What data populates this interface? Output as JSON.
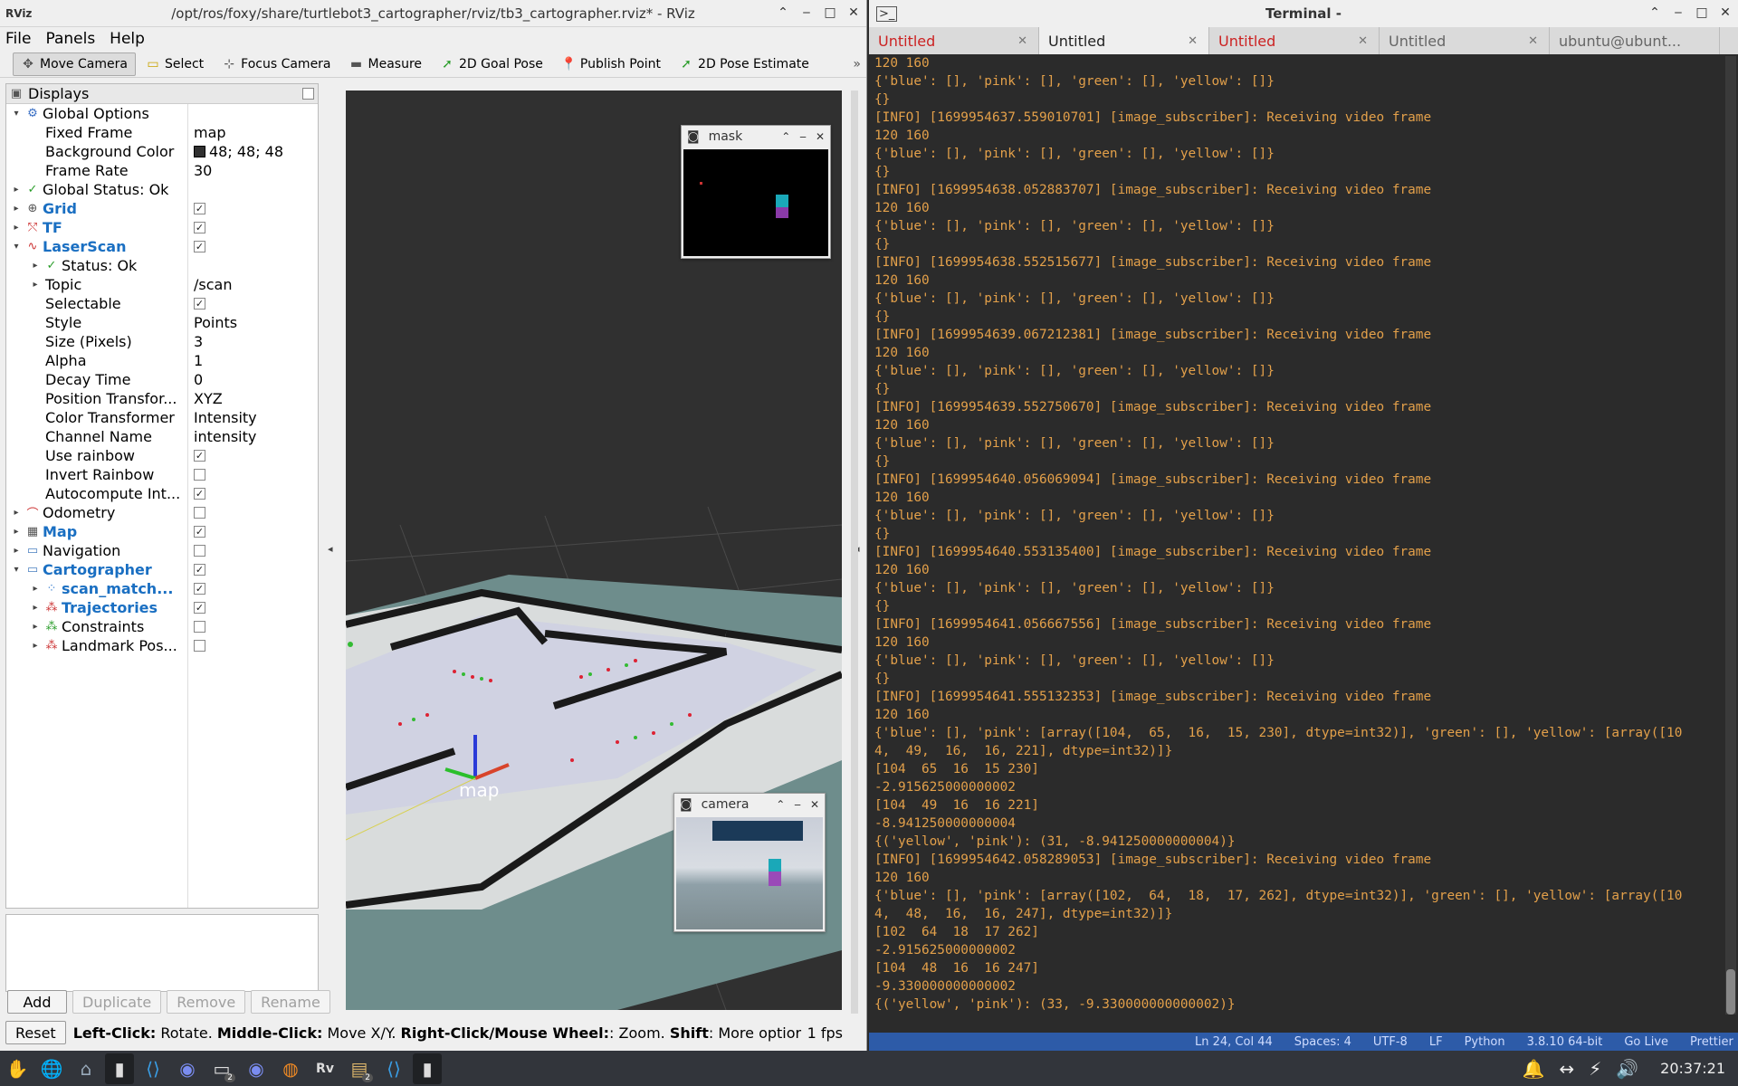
{
  "rviz": {
    "app_icon": "RViz",
    "title": "/opt/ros/foxy/share/turtlebot3_cartographer/rviz/tb3_cartographer.rviz* - RViz",
    "menu": [
      "File",
      "Panels",
      "Help"
    ],
    "tools": [
      {
        "label": "Move Camera",
        "icon": "move-camera-icon"
      },
      {
        "label": "Select",
        "icon": "select-icon"
      },
      {
        "label": "Focus Camera",
        "icon": "focus-camera-icon"
      },
      {
        "label": "Measure",
        "icon": "measure-icon"
      },
      {
        "label": "2D Goal Pose",
        "icon": "goal-pose-icon"
      },
      {
        "label": "Publish Point",
        "icon": "publish-point-icon"
      },
      {
        "label": "2D Pose Estimate",
        "icon": "pose-estimate-icon"
      }
    ],
    "displays_title": "Displays",
    "tree": [
      {
        "indent": 0,
        "arrow": "▾",
        "icon": "⚙",
        "icolor": "#3a6fc4",
        "name": "Global Options",
        "bold": false,
        "value": ""
      },
      {
        "indent": 1,
        "arrow": "",
        "name": "Fixed Frame",
        "value": "map"
      },
      {
        "indent": 1,
        "arrow": "",
        "name": "Background Color",
        "value": "48; 48; 48",
        "swatch": "#303030"
      },
      {
        "indent": 1,
        "arrow": "",
        "name": "Frame Rate",
        "value": "30"
      },
      {
        "indent": 0,
        "arrow": "▸",
        "icon": "✓",
        "icolor": "#2a9d2a",
        "name": "Global Status: Ok",
        "value": ""
      },
      {
        "indent": 0,
        "arrow": "▸",
        "icon": "⊕",
        "icolor": "#555",
        "name": "Grid",
        "bold": true,
        "check": true
      },
      {
        "indent": 0,
        "arrow": "▸",
        "icon": "⤲",
        "icolor": "#c33",
        "name": "TF",
        "bold": true,
        "check": true
      },
      {
        "indent": 0,
        "arrow": "▾",
        "icon": "∿",
        "icolor": "#c33",
        "name": "LaserScan",
        "bold": true,
        "check": true
      },
      {
        "indent": 1,
        "arrow": "▸",
        "icon": "✓",
        "icolor": "#2a9d2a",
        "name": "Status: Ok",
        "value": ""
      },
      {
        "indent": 1,
        "arrow": "▸",
        "name": "Topic",
        "value": "/scan"
      },
      {
        "indent": 1,
        "arrow": "",
        "name": "Selectable",
        "check": true
      },
      {
        "indent": 1,
        "arrow": "",
        "name": "Style",
        "value": "Points"
      },
      {
        "indent": 1,
        "arrow": "",
        "name": "Size (Pixels)",
        "value": "3"
      },
      {
        "indent": 1,
        "arrow": "",
        "name": "Alpha",
        "value": "1"
      },
      {
        "indent": 1,
        "arrow": "",
        "name": "Decay Time",
        "value": "0"
      },
      {
        "indent": 1,
        "arrow": "",
        "name": "Position Transfor...",
        "value": "XYZ"
      },
      {
        "indent": 1,
        "arrow": "",
        "name": "Color Transformer",
        "value": "Intensity"
      },
      {
        "indent": 1,
        "arrow": "",
        "name": "Channel Name",
        "value": "intensity"
      },
      {
        "indent": 1,
        "arrow": "",
        "name": "Use rainbow",
        "check": true
      },
      {
        "indent": 1,
        "arrow": "",
        "name": "Invert Rainbow",
        "check": false
      },
      {
        "indent": 1,
        "arrow": "",
        "name": "Autocompute Int...",
        "check": true
      },
      {
        "indent": 0,
        "arrow": "▸",
        "icon": "⌒",
        "icolor": "#c33",
        "name": "Odometry",
        "check": false
      },
      {
        "indent": 0,
        "arrow": "▸",
        "icon": "▦",
        "icolor": "#555",
        "name": "Map",
        "bold": true,
        "check": true
      },
      {
        "indent": 0,
        "arrow": "▸",
        "icon": "▭",
        "icolor": "#4a7fc0",
        "name": "Navigation",
        "check": false
      },
      {
        "indent": 0,
        "arrow": "▾",
        "icon": "▭",
        "icolor": "#4a7fc0",
        "name": "Cartographer",
        "bold": true,
        "check": true
      },
      {
        "indent": 1,
        "arrow": "▸",
        "icon": "⁘",
        "icolor": "#3a7fd0",
        "name": "scan_match...",
        "bold": true,
        "check": true
      },
      {
        "indent": 1,
        "arrow": "▸",
        "icon": "⁂",
        "icolor": "#c33",
        "name": "Trajectories",
        "bold": true,
        "check": true
      },
      {
        "indent": 1,
        "arrow": "▸",
        "icon": "⁂",
        "icolor": "#2a9d2a",
        "name": "Constraints",
        "check": false
      },
      {
        "indent": 1,
        "arrow": "▸",
        "icon": "⁂",
        "icolor": "#c33",
        "name": "Landmark Pos...",
        "check": false
      }
    ],
    "buttons": [
      {
        "label": "Add",
        "enabled": true
      },
      {
        "label": "Duplicate",
        "enabled": false
      },
      {
        "label": "Remove",
        "enabled": false
      },
      {
        "label": "Rename",
        "enabled": false
      }
    ],
    "reset_label": "Reset",
    "status_parts": [
      {
        "t": "Left-Click:",
        "b": true
      },
      {
        "t": " Rotate. ",
        "b": false
      },
      {
        "t": "Middle-Click:",
        "b": true
      },
      {
        "t": " Move X/Y. ",
        "b": false
      },
      {
        "t": "Right-Click/Mouse Wheel:",
        "b": true
      },
      {
        "t": ": Zoom. ",
        "b": false
      },
      {
        "t": "Shift",
        "b": true
      },
      {
        "t": ": More optior",
        "b": false
      }
    ],
    "fps": "1 fps",
    "map_label": "map",
    "mask_title": "mask",
    "camera_title": "camera"
  },
  "terminal": {
    "title": "Terminal -",
    "tabs": [
      {
        "label": "Untitled",
        "red": true,
        "active": false
      },
      {
        "label": "Untitled",
        "red": false,
        "active": true
      },
      {
        "label": "Untitled",
        "red": true,
        "active": false
      },
      {
        "label": "Untitled",
        "red": false,
        "active": false
      },
      {
        "label": "ubuntu@ubunt...",
        "red": false,
        "active": false
      }
    ],
    "lines": [
      "120 160",
      "{'blue': [], 'pink': [], 'green': [], 'yellow': []}",
      "{}",
      "[INFO] [1699954637.559010701] [image_subscriber]: Receiving video frame",
      "120 160",
      "{'blue': [], 'pink': [], 'green': [], 'yellow': []}",
      "{}",
      "[INFO] [1699954638.052883707] [image_subscriber]: Receiving video frame",
      "120 160",
      "{'blue': [], 'pink': [], 'green': [], 'yellow': []}",
      "{}",
      "[INFO] [1699954638.552515677] [image_subscriber]: Receiving video frame",
      "120 160",
      "{'blue': [], 'pink': [], 'green': [], 'yellow': []}",
      "{}",
      "[INFO] [1699954639.067212381] [image_subscriber]: Receiving video frame",
      "120 160",
      "{'blue': [], 'pink': [], 'green': [], 'yellow': []}",
      "{}",
      "[INFO] [1699954639.552750670] [image_subscriber]: Receiving video frame",
      "120 160",
      "{'blue': [], 'pink': [], 'green': [], 'yellow': []}",
      "{}",
      "[INFO] [1699954640.056069094] [image_subscriber]: Receiving video frame",
      "120 160",
      "{'blue': [], 'pink': [], 'green': [], 'yellow': []}",
      "{}",
      "[INFO] [1699954640.553135400] [image_subscriber]: Receiving video frame",
      "120 160",
      "{'blue': [], 'pink': [], 'green': [], 'yellow': []}",
      "{}",
      "[INFO] [1699954641.056667556] [image_subscriber]: Receiving video frame",
      "120 160",
      "{'blue': [], 'pink': [], 'green': [], 'yellow': []}",
      "{}",
      "[INFO] [1699954641.555132353] [image_subscriber]: Receiving video frame",
      "120 160",
      "{'blue': [], 'pink': [array([104,  65,  16,  15, 230], dtype=int32)], 'green': [], 'yellow': [array([10",
      "4,  49,  16,  16, 221], dtype=int32)]}",
      "[104  65  16  15 230]",
      "-2.915625000000002",
      "[104  49  16  16 221]",
      "-8.941250000000004",
      "{('yellow', 'pink'): (31, -8.941250000000004)}",
      "[INFO] [1699954642.058289053] [image_subscriber]: Receiving video frame",
      "120 160",
      "{'blue': [], 'pink': [array([102,  64,  18,  17, 262], dtype=int32)], 'green': [], 'yellow': [array([10",
      "4,  48,  16,  16, 247], dtype=int32)]}",
      "[102  64  18  17 262]",
      "-2.915625000000002",
      "[104  48  16  16 247]",
      "-9.330000000000002",
      "{('yellow', 'pink'): (33, -9.330000000000002)}"
    ],
    "vscode_status": [
      "Ln 24, Col 44",
      "Spaces: 4",
      "UTF-8",
      "LF",
      "Python",
      "3.8.10 64-bit",
      "Go Live",
      "Prettier"
    ]
  },
  "taskbar": {
    "icons": [
      "start-icon",
      "browser-globe-icon",
      "home-folder-icon",
      "terminal-icon",
      "vscode-icon",
      "discord-icon",
      "window-switcher-icon",
      "discord-icon",
      "firefox-icon",
      "rviz-icon",
      "files-icon",
      "vscode-icon",
      "terminal-icon"
    ],
    "clock": "20:37:21",
    "badge_count": "2"
  }
}
